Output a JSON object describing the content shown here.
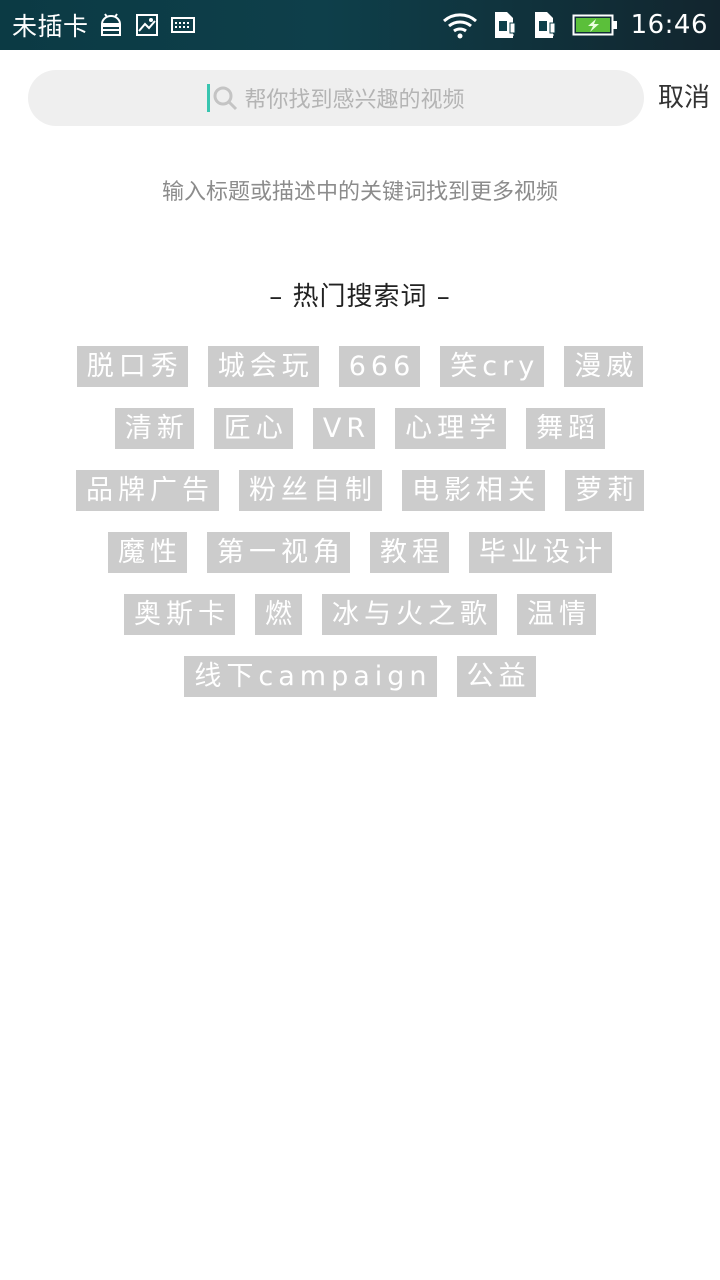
{
  "status_bar": {
    "carrier": "未插卡",
    "time": "16:46",
    "icons": [
      "android-debug-icon",
      "image-icon",
      "keyboard-icon",
      "wifi-icon",
      "sim-alert-icon",
      "sim-alert-icon",
      "battery-charging-icon"
    ]
  },
  "search": {
    "placeholder": "帮你找到感兴趣的视频",
    "cancel_label": "取消"
  },
  "hint": "输入标题或描述中的关键词找到更多视频",
  "hot": {
    "title": "– 热门搜索词 –",
    "rows": [
      [
        "脱口秀",
        "城会玩",
        "666",
        "笑cry",
        "漫威"
      ],
      [
        "清新",
        "匠心",
        "VR",
        "心理学",
        "舞蹈"
      ],
      [
        "品牌广告",
        "粉丝自制",
        "电影相关",
        "萝莉"
      ],
      [
        "魔性",
        "第一视角",
        "教程",
        "毕业设计"
      ],
      [
        "奥斯卡",
        "燃",
        "冰与火之歌",
        "温情"
      ],
      [
        "线下campaign",
        "公益"
      ]
    ]
  },
  "colors": {
    "status_bar": "#0e3f4a",
    "search_bg": "#efefef",
    "cursor": "#39c5b0",
    "tag_bg": "#cccccc",
    "tag_text": "#ffffff"
  }
}
